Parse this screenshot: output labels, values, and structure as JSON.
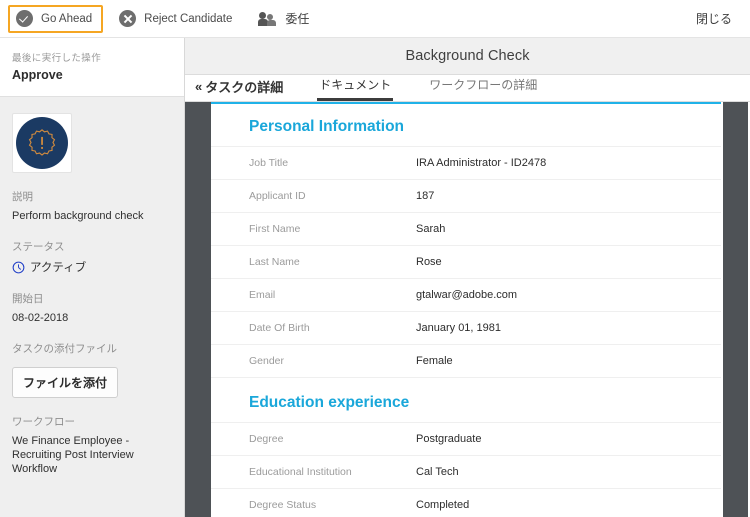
{
  "toolbar": {
    "actions": [
      {
        "label": "Go Ahead",
        "icon": "circle-check-icon",
        "focused": true
      },
      {
        "label": "Reject Candidate",
        "icon": "circle-x-icon",
        "focused": false
      },
      {
        "label": "委任",
        "icon": "delegate-people-icon",
        "focused": false
      }
    ],
    "close_label": "閉じる"
  },
  "header": {
    "title": "Background Check"
  },
  "tabs": {
    "back_label": "タスクの詳細",
    "back_chevron": "«",
    "items": [
      {
        "label": "ドキュメント",
        "active": true
      },
      {
        "label": "ワークフローの詳細",
        "active": false
      }
    ]
  },
  "sidebar": {
    "last_action_label": "最後に実行した操作",
    "last_action_value": "Approve",
    "avatar_icon": "badge-exclamation-icon",
    "description_label": "説明",
    "description_value": "Perform background check",
    "status_label": "ステータス",
    "status_icon": "clock-active-icon",
    "status_value": "アクティブ",
    "start_date_label": "開始日",
    "start_date_value": "08-02-2018",
    "attachments_label": "タスクの添付ファイル",
    "attach_button_label": "ファイルを添付",
    "workflow_label": "ワークフロー",
    "workflow_value": "We Finance Employee - Recruiting Post Interview Workflow"
  },
  "content": {
    "sections": [
      {
        "title": "Personal Information",
        "rows": [
          {
            "key": "Job Title",
            "value": "IRA Administrator - ID2478"
          },
          {
            "key": "Applicant ID",
            "value": "187"
          },
          {
            "key": "First Name",
            "value": "Sarah"
          },
          {
            "key": "Last Name",
            "value": "Rose"
          },
          {
            "key": "Email",
            "value": "gtalwar@adobe.com"
          },
          {
            "key": "Date Of Birth",
            "value": "January 01, 1981"
          },
          {
            "key": "Gender",
            "value": "Female"
          }
        ]
      },
      {
        "title": "Education experience",
        "rows": [
          {
            "key": "Degree",
            "value": "Postgraduate"
          },
          {
            "key": "Educational Institution",
            "value": "Cal Tech"
          },
          {
            "key": "Degree Status",
            "value": "Completed"
          }
        ]
      }
    ]
  },
  "colors": {
    "accent_cyan": "#1aa7da",
    "focus_orange": "#f5a623",
    "dark_bar": "#4e5256",
    "avatar_navy": "#1b3a63",
    "avatar_badge": "#d08a3e"
  }
}
